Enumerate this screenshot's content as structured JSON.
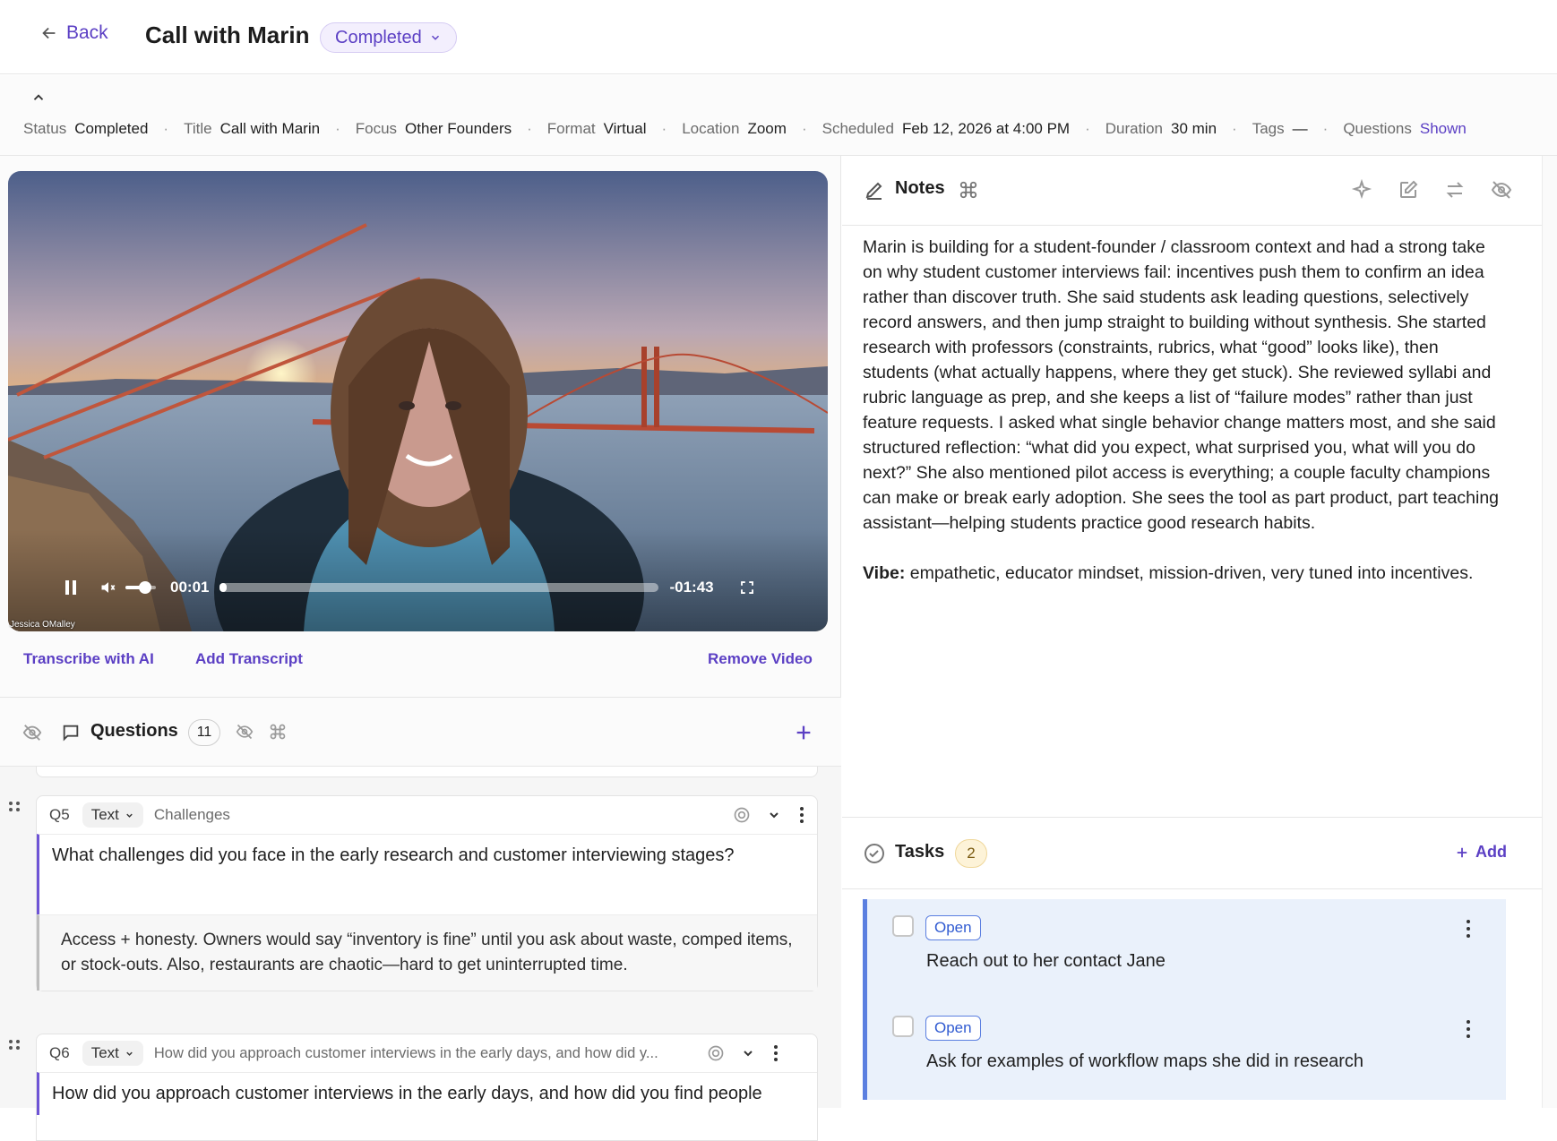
{
  "header": {
    "back_label": "Back",
    "title": "Call with Marin",
    "status": "Completed"
  },
  "meta": [
    {
      "label": "Status",
      "value": "Completed"
    },
    {
      "label": "Title",
      "value": "Call with Marin"
    },
    {
      "label": "Focus",
      "value": "Other Founders"
    },
    {
      "label": "Format",
      "value": "Virtual"
    },
    {
      "label": "Location",
      "value": "Zoom"
    },
    {
      "label": "Scheduled",
      "value": "Feb 12, 2026 at 4:00 PM"
    },
    {
      "label": "Duration",
      "value": "30 min"
    },
    {
      "label": "Tags",
      "value": "—"
    },
    {
      "label": "Questions",
      "value": "Shown"
    }
  ],
  "video": {
    "elapsed": "00:01",
    "remaining": "-01:43",
    "caption": "Jessica OMalley",
    "progress": 0.01,
    "volume": 0.5
  },
  "video_actions": {
    "transcribe": "Transcribe with AI",
    "add_transcript": "Add Transcript",
    "remove": "Remove Video"
  },
  "questions": {
    "title": "Questions",
    "count": "11",
    "items": [
      {
        "number": "Q5",
        "type": "Text",
        "tag": "Challenges",
        "question": "What challenges did you face in the early research and customer interviewing stages?",
        "answer": "Access + honesty. Owners would say “inventory is fine” until you ask about waste, comped items, or stock-outs. Also, restaurants are chaotic—hard to get uninterrupted time."
      },
      {
        "number": "Q6",
        "type": "Text",
        "tag": "How did you approach customer interviews in the early days, and how did y...",
        "question": "How did you approach customer interviews in the early days, and how did you find people"
      }
    ]
  },
  "notes": {
    "title": "Notes",
    "body": "Marin is building for a student-founder / classroom context and had a strong take on why student customer interviews fail: incentives push them to confirm an idea rather than discover truth. She said students ask leading questions, selectively record answers, and then jump straight to building without synthesis. She started research with professors (constraints, rubrics, what “good” looks like), then students (what actually happens, where they get stuck). She reviewed syllabi and rubric language as prep, and she keeps a list of “failure modes” rather than just feature requests. I asked what single behavior change matters most, and she said structured reflection: “what did you expect, what surprised you, what will you do next?” She also mentioned pilot access is everything; a couple faculty champions can make or break early adoption. She sees the tool as part product, part teaching assistant—helping students practice good research habits.",
    "vibe_label": "Vibe:",
    "vibe_text": " empathetic, educator mindset, mission-driven, very tuned into incentives."
  },
  "tasks": {
    "title": "Tasks",
    "count": "2",
    "add_label": "Add",
    "items": [
      {
        "status": "Open",
        "text": "Reach out to her contact Jane"
      },
      {
        "status": "Open",
        "text": "Ask for examples of workflow maps she did in research"
      }
    ]
  },
  "colors": {
    "accent": "#5b3fc4",
    "task_accent": "#5b7fe0",
    "task_bg": "#eaf1fb"
  }
}
